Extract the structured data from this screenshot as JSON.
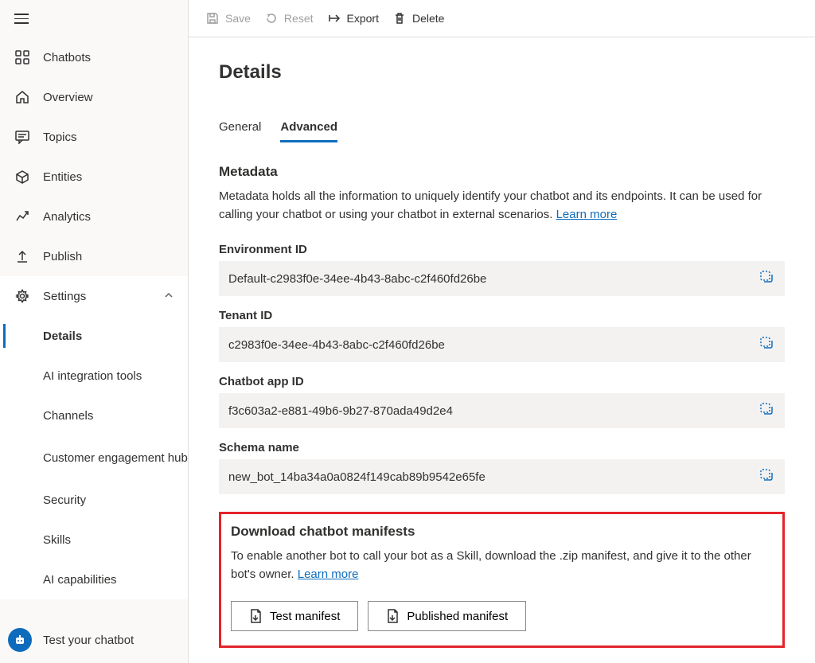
{
  "sidebar": {
    "items": [
      {
        "label": "Chatbots"
      },
      {
        "label": "Overview"
      },
      {
        "label": "Topics"
      },
      {
        "label": "Entities"
      },
      {
        "label": "Analytics"
      },
      {
        "label": "Publish"
      },
      {
        "label": "Settings"
      }
    ],
    "settings_sub": [
      {
        "label": "Details"
      },
      {
        "label": "AI integration tools"
      },
      {
        "label": "Channels"
      },
      {
        "label": "Customer engagement hub"
      },
      {
        "label": "Security"
      },
      {
        "label": "Skills"
      },
      {
        "label": "AI capabilities"
      }
    ],
    "footer": {
      "label": "Test your chatbot"
    }
  },
  "toolbar": {
    "save": "Save",
    "reset": "Reset",
    "export": "Export",
    "delete": "Delete"
  },
  "page": {
    "title": "Details",
    "tabs": {
      "general": "General",
      "advanced": "Advanced"
    },
    "metadata": {
      "heading": "Metadata",
      "desc_part1": "Metadata holds all the information to uniquely identify your chatbot and its endpoints. It can be used for calling your chatbot or using your chatbot in external scenarios. ",
      "learn_more": "Learn more"
    },
    "fields": {
      "env_label": "Environment ID",
      "env_value": "Default-c2983f0e-34ee-4b43-8abc-c2f460fd26be",
      "tenant_label": "Tenant ID",
      "tenant_value": "c2983f0e-34ee-4b43-8abc-c2f460fd26be",
      "appid_label": "Chatbot app ID",
      "appid_value": "f3c603a2-e881-49b6-9b27-870ada49d2e4",
      "schema_label": "Schema name",
      "schema_value": "new_bot_14ba34a0a0824f149cab89b9542e65fe"
    },
    "manifests": {
      "heading": "Download chatbot manifests",
      "desc_part1": "To enable another bot to call your bot as a Skill, download the .zip manifest, and give it to the other bot's owner. ",
      "learn_more": "Learn more",
      "test_btn": "Test manifest",
      "pub_btn": "Published manifest"
    }
  }
}
